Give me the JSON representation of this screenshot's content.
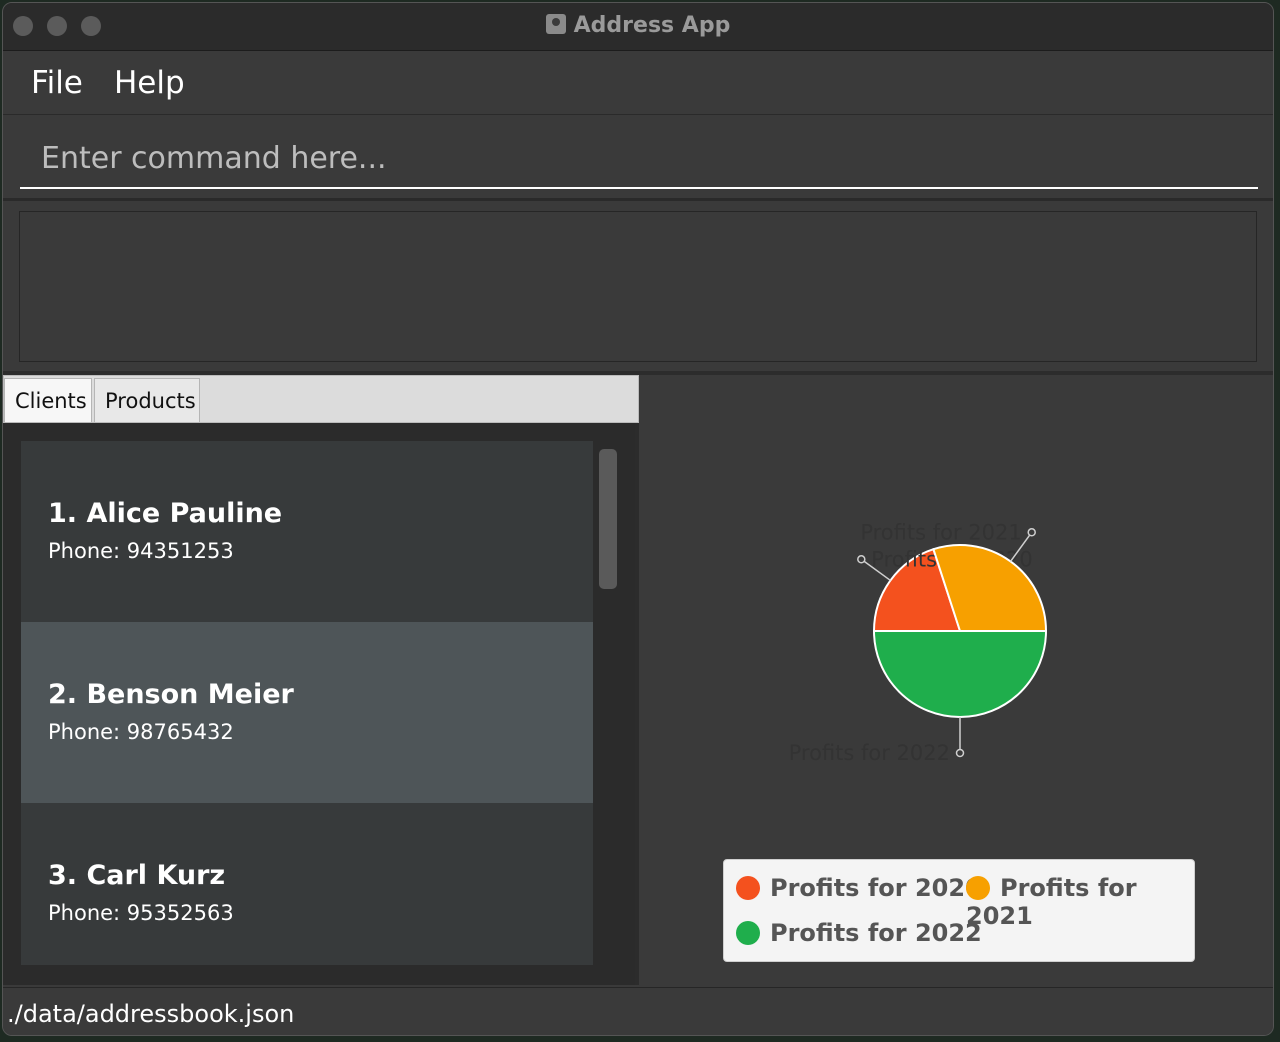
{
  "window": {
    "title": "Address App"
  },
  "menu": {
    "file": "File",
    "help": "Help"
  },
  "command": {
    "placeholder": "Enter command here...",
    "value": ""
  },
  "tabs": {
    "clients": "Clients",
    "products": "Products",
    "selected": "Clients"
  },
  "clients": [
    {
      "name": "1.  Alice Pauline",
      "phone": "Phone: 94351253",
      "selected": false
    },
    {
      "name": "2.  Benson Meier",
      "phone": "Phone: 98765432",
      "selected": true
    },
    {
      "name": "3.  Carl Kurz",
      "phone": "Phone: 95352563",
      "selected": false
    }
  ],
  "status": {
    "file_path": "./data/addressbook.json"
  },
  "chart_data": {
    "type": "pie",
    "title": "",
    "series": [
      {
        "name": "Profits for 2020",
        "value": 20,
        "color": "#f4511e"
      },
      {
        "name": "Profits for 2021",
        "value": 30,
        "color": "#f7a000"
      },
      {
        "name": "Profits for 2022",
        "value": 50,
        "color": "#1fae4c"
      }
    ],
    "legend": "bottom"
  }
}
